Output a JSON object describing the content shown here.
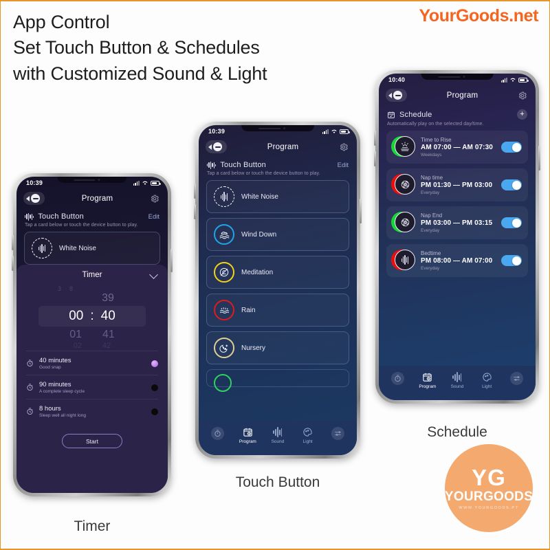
{
  "headline": {
    "line1": "App Control",
    "line2": "Set Touch Button & Schedules",
    "line3": "with Customized Sound & Light"
  },
  "brand": {
    "text": "YourGoods.net",
    "color": "#f4651f"
  },
  "badge": {
    "initials": "YG",
    "name": "YOURGOODS",
    "url": "WWW.YOURGOODS.PT",
    "color": "#f4a96f"
  },
  "captions": {
    "timer": "Timer",
    "touch_button": "Touch Button",
    "schedule": "Schedule"
  },
  "phone_timer": {
    "status": {
      "time": "10:39",
      "signal_icon": "signal-bars-icon",
      "wifi_icon": "wifi-icon",
      "battery_icon": "battery-icon"
    },
    "nav": {
      "back_icon": "back-chevron-icon",
      "device_icon": "device-icon",
      "title": "Program",
      "settings_icon": "gear-icon"
    },
    "section": {
      "icon": "sound-wave-icon",
      "title": "Touch Button",
      "action": "Edit",
      "subtitle": "Tap a card below or touch the device button to play."
    },
    "card": {
      "label": "White Noise",
      "icon": "white-noise-icon",
      "ring_color": "#ffffff"
    },
    "sheet": {
      "title": "Timer",
      "collapse_icon": "chevron-down-icon",
      "picker": {
        "ghost_top": "38",
        "above": "39",
        "hours": "00",
        "separator": ":",
        "minutes": "40",
        "below_hours": "01",
        "below_minutes": "41",
        "faint_hours": "02",
        "faint_minutes": "42"
      },
      "presets": [
        {
          "icon": "stopwatch-icon",
          "title": "40 minutes",
          "desc": "Good snap",
          "selected": true
        },
        {
          "icon": "stopwatch-icon",
          "title": "90 minutes",
          "desc": "A complete sleep cycle",
          "selected": false
        },
        {
          "icon": "stopwatch-icon",
          "title": "8 hours",
          "desc": "Sleep well all night long",
          "selected": false
        }
      ],
      "start_label": "Start"
    }
  },
  "phone_touch": {
    "status": {
      "time": "10:39"
    },
    "nav": {
      "title": "Program"
    },
    "section": {
      "title": "Touch Button",
      "action": "Edit",
      "subtitle": "Tap a card below or touch the device button to play."
    },
    "cards": [
      {
        "label": "White Noise",
        "icon": "white-noise-icon",
        "ring_color": "#ffffff",
        "dashed": true
      },
      {
        "label": "Wind Down",
        "icon": "waves-icon",
        "ring_color": "#1ea7e8",
        "dashed": false
      },
      {
        "label": "Meditation",
        "icon": "mute-bell-icon",
        "ring_color": "#f2d516",
        "dashed": false
      },
      {
        "label": "Rain",
        "icon": "rain-icon",
        "ring_color": "#e01b1b",
        "dashed": false
      },
      {
        "label": "Nursery",
        "icon": "moon-face-icon",
        "ring_color": "#e3cf96",
        "dashed": false
      }
    ],
    "partial_card_color": "#2fd15f",
    "tabs": [
      {
        "label": "",
        "icon": "timer-icon",
        "active": false,
        "circle": true
      },
      {
        "label": "Program",
        "icon": "calendar-clock-icon",
        "active": true,
        "circle": false
      },
      {
        "label": "Sound",
        "icon": "sound-wave-icon",
        "active": false,
        "circle": false
      },
      {
        "label": "Light",
        "icon": "palette-icon",
        "active": false,
        "circle": false
      },
      {
        "label": "",
        "icon": "sliders-icon",
        "active": false,
        "circle": true
      }
    ]
  },
  "phone_schedule": {
    "status": {
      "time": "10:40"
    },
    "nav": {
      "title": "Program"
    },
    "section": {
      "icon": "calendar-check-icon",
      "title": "Schedule",
      "add_label": "+",
      "subtitle": "Automatically play on the selected day/time."
    },
    "rows": [
      {
        "name": "Time to Rise",
        "time": "AM 07:00 — AM 07:30",
        "days": "Weekdays",
        "accent": "#16d63a",
        "icon": "sunrise-icon",
        "enabled": true
      },
      {
        "name": "Nap time",
        "time": "PM 01:30 — PM 03:00",
        "days": "Everyday",
        "accent": "#ea0f0f",
        "icon": "fan-icon",
        "enabled": true
      },
      {
        "name": "Nap End",
        "time": "PM 03:00 — PM 03:15",
        "days": "Everyday",
        "accent": "#16d63a",
        "icon": "fan-icon",
        "enabled": true
      },
      {
        "name": "Bedtime",
        "time": "PM 08:00 — AM 07:00",
        "days": "Everyday",
        "accent": "#ea0f0f",
        "icon": "white-noise-icon",
        "enabled": true
      }
    ],
    "tabs": [
      {
        "label": "",
        "icon": "timer-icon",
        "active": false,
        "circle": true
      },
      {
        "label": "Program",
        "icon": "calendar-clock-icon",
        "active": true,
        "circle": false
      },
      {
        "label": "Sound",
        "icon": "sound-wave-icon",
        "active": false,
        "circle": false
      },
      {
        "label": "Light",
        "icon": "palette-icon",
        "active": false,
        "circle": false
      },
      {
        "label": "",
        "icon": "sliders-icon",
        "active": false,
        "circle": true
      }
    ]
  }
}
